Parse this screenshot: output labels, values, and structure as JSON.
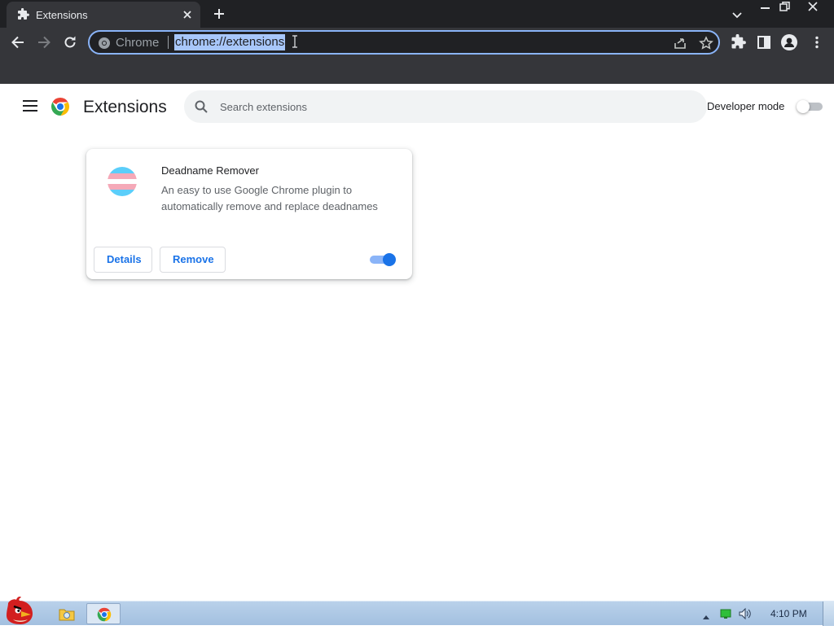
{
  "browser": {
    "tab": {
      "title": "Extensions",
      "icon": "puzzle-icon"
    },
    "omnibox": {
      "site_chip": "Chrome",
      "url": "chrome://extensions"
    }
  },
  "page": {
    "title": "Extensions",
    "search": {
      "placeholder": "Search extensions",
      "value": ""
    },
    "developer_mode": {
      "label": "Developer mode",
      "enabled": false
    }
  },
  "extensions": [
    {
      "name": "Deadname Remover",
      "description": "An easy to use Google Chrome plugin to automatically remove and replace deadnames",
      "details_label": "Details",
      "remove_label": "Remove",
      "enabled": true,
      "icon": "trans-flag-icon"
    }
  ],
  "taskbar": {
    "clock": "4:10 PM"
  },
  "colors": {
    "accent": "#1a73e8",
    "toggle_track_on": "#8ab4f8",
    "omnibox_focus": "#8ab4f8",
    "dark_frame": "#202124",
    "toolbar": "#35363a"
  }
}
